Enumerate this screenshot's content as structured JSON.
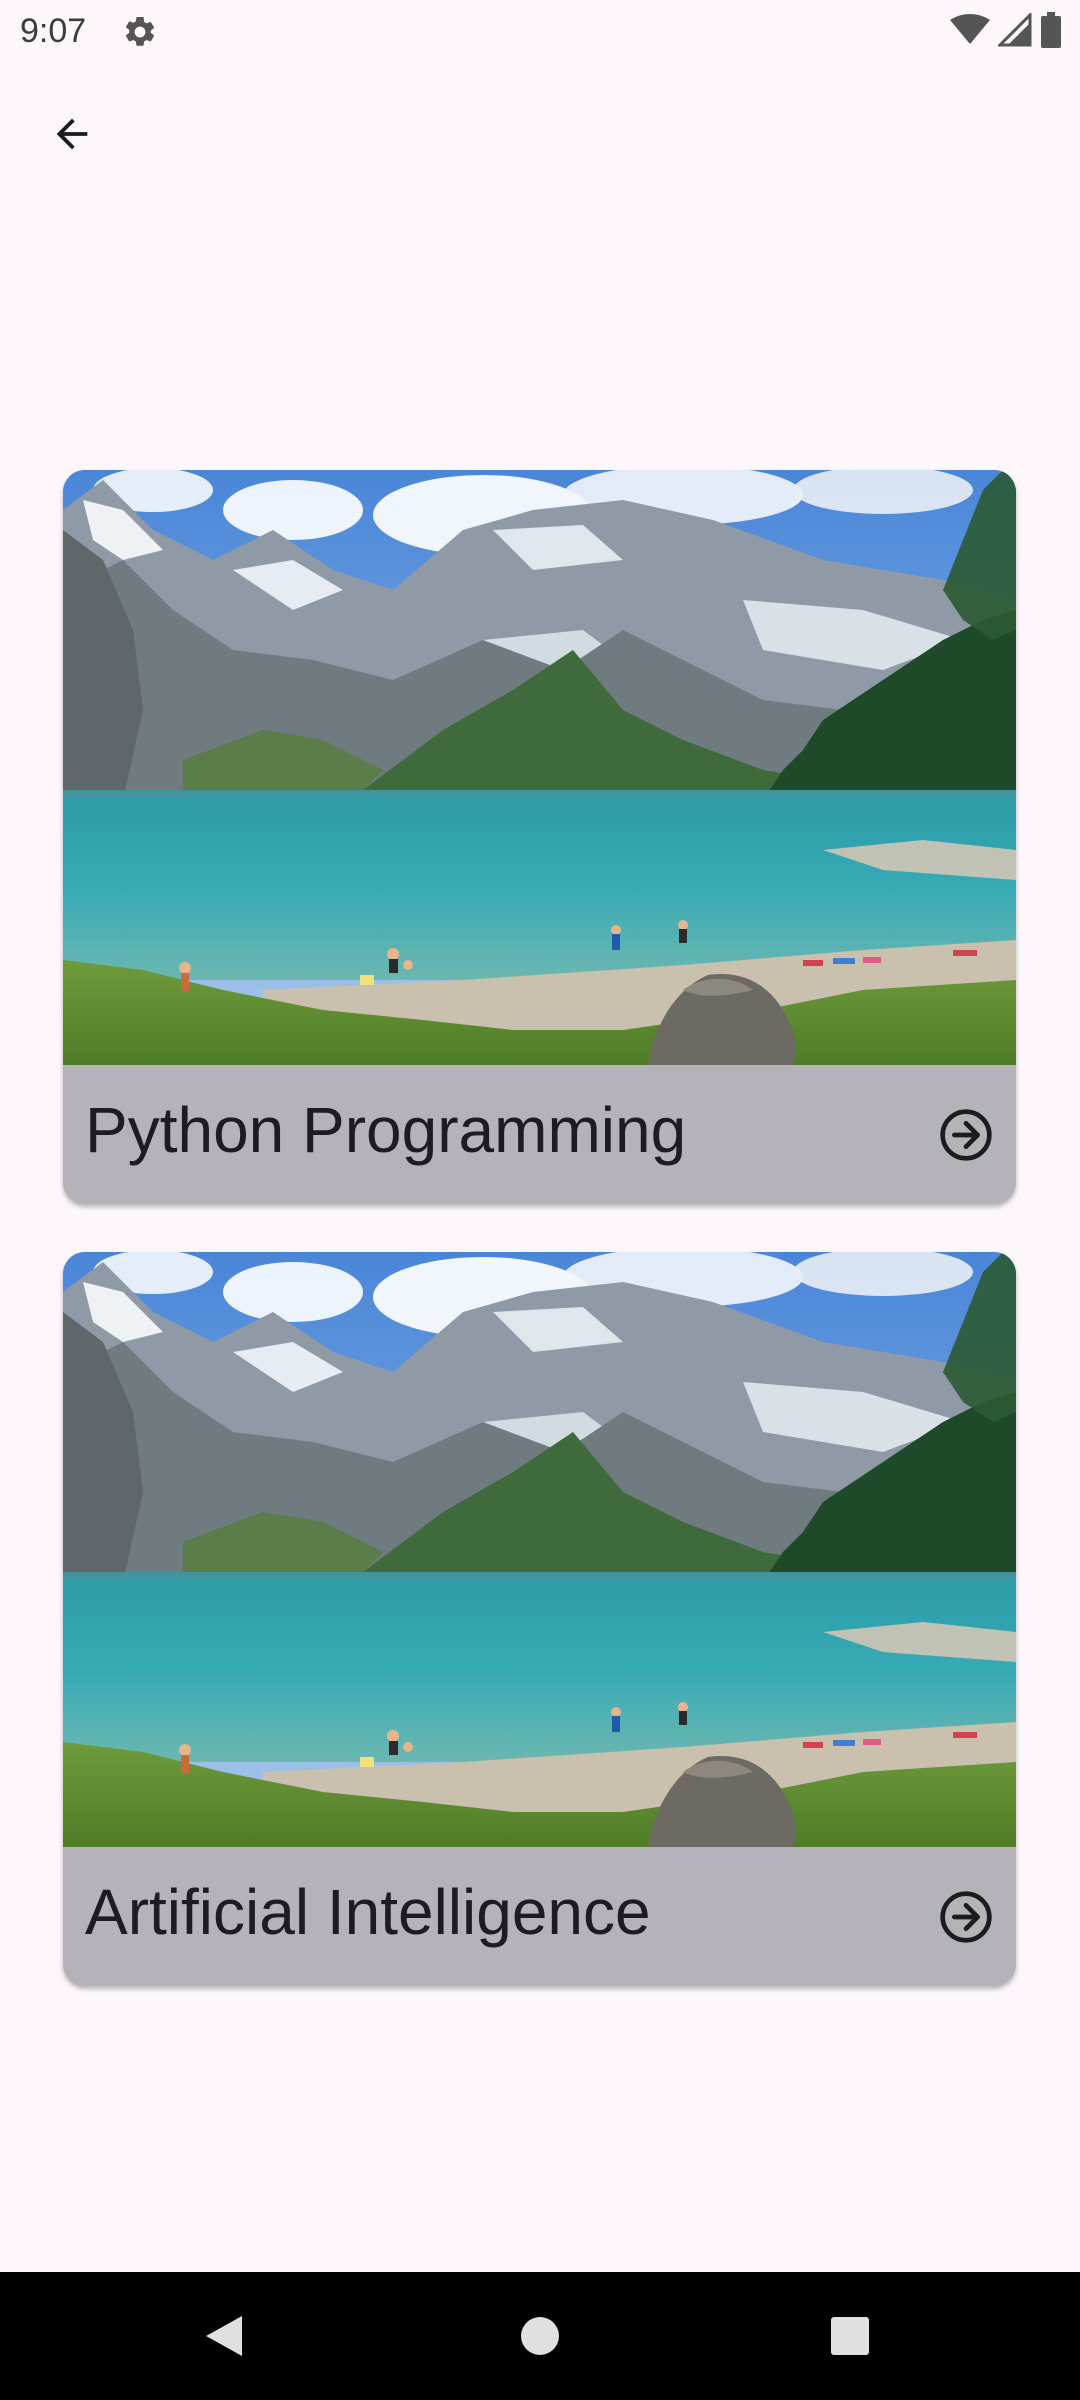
{
  "status_bar": {
    "time": "9:07",
    "settings_icon": "gear-icon",
    "wifi_icon": "wifi-icon",
    "signal_icon": "cellular-signal-icon",
    "battery_icon": "battery-icon"
  },
  "app_bar": {
    "back_icon": "arrow-back-icon"
  },
  "cards": [
    {
      "title": "Python Programming",
      "action_icon": "arrow-circle-right-icon"
    },
    {
      "title": "Artificial Intelligence",
      "action_icon": "arrow-circle-right-icon"
    }
  ],
  "nav_bar": {
    "back_icon": "nav-back-triangle-icon",
    "home_icon": "nav-home-circle-icon",
    "recents_icon": "nav-recents-square-icon"
  },
  "colors": {
    "background": "#fdf7fb",
    "card_footer": "#b6b2ba",
    "nav_bar": "#000000"
  }
}
